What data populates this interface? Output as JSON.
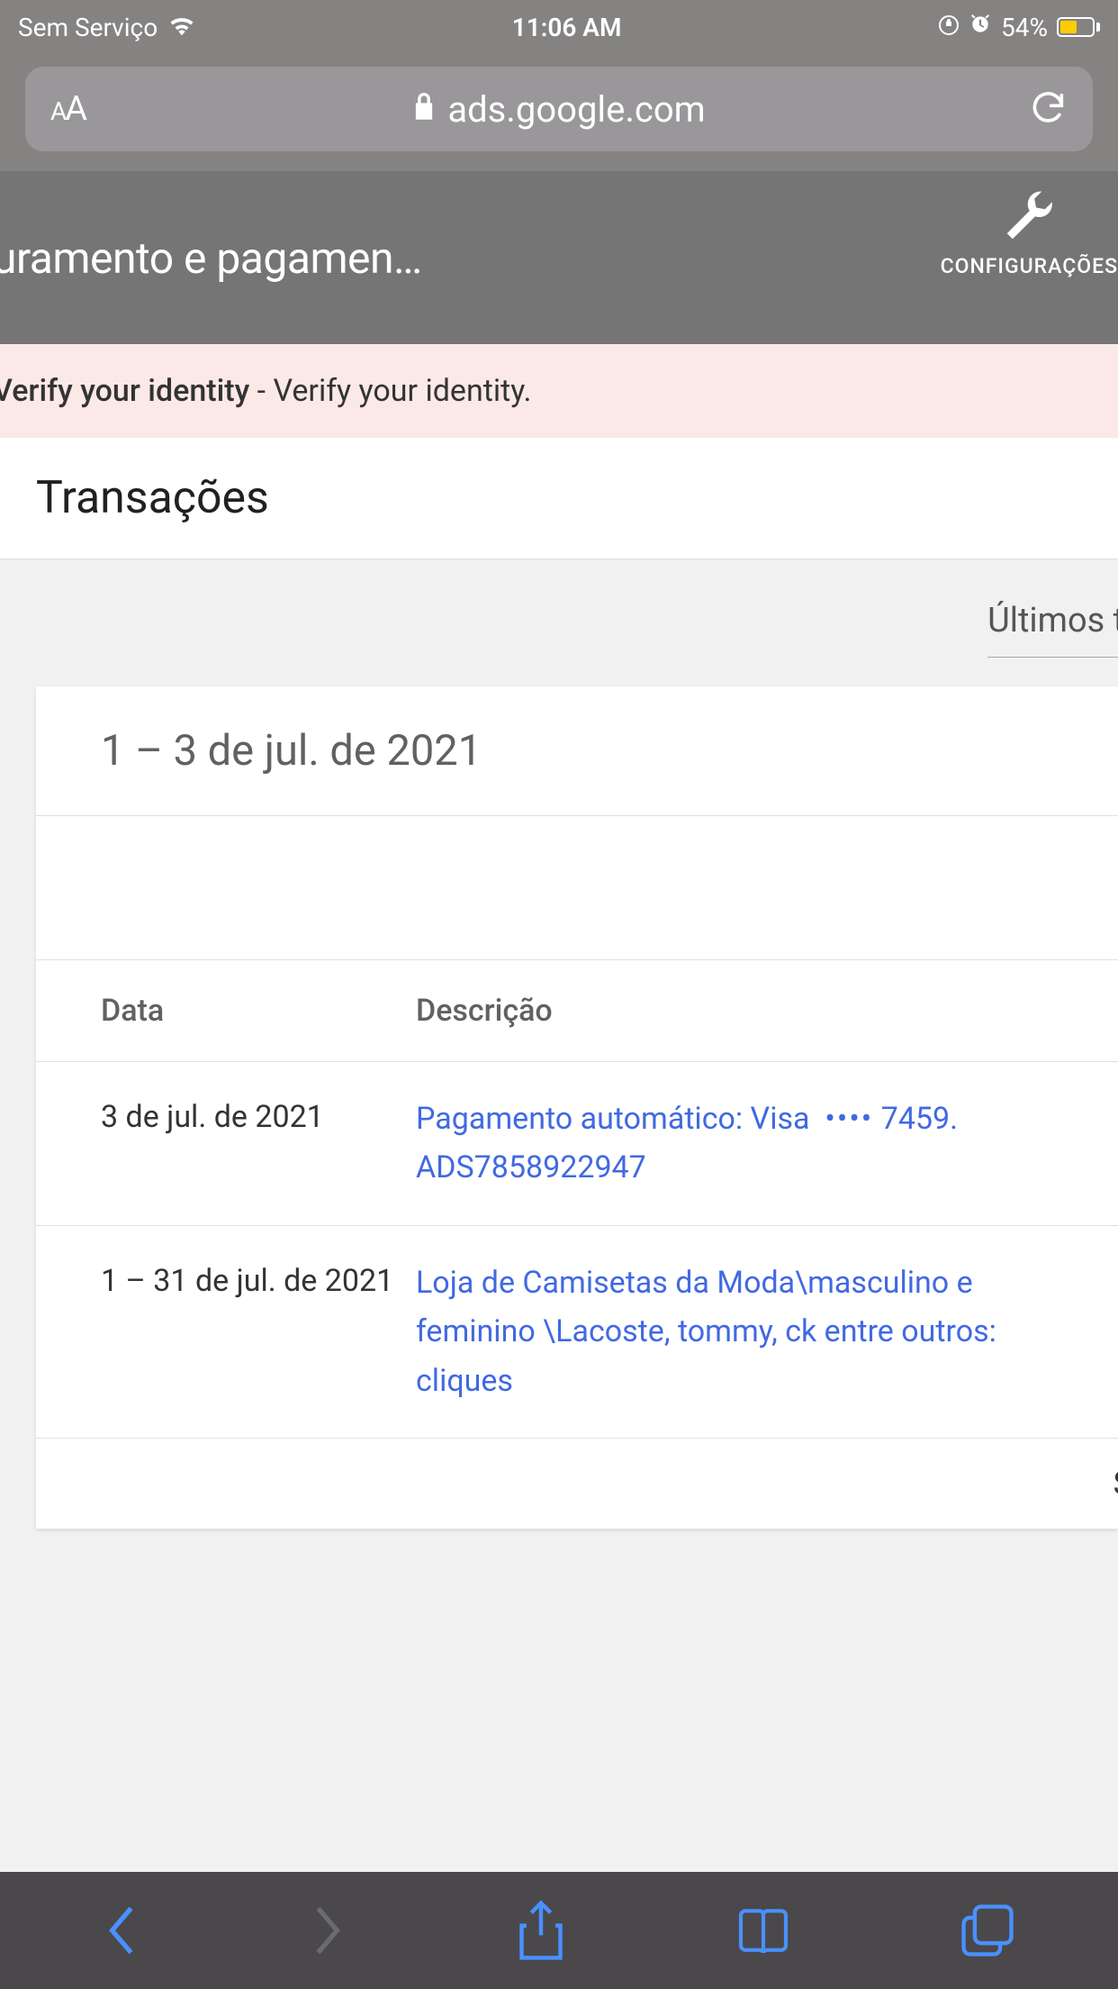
{
  "status_bar": {
    "carrier": "Sem Serviço",
    "time": "11:06 AM",
    "battery_pct": "54%"
  },
  "url_bar": {
    "domain": "ads.google.com"
  },
  "header": {
    "title": "uramento e pagamen…",
    "settings_label": "CONFIGURAÇÕES"
  },
  "alert": {
    "bold": "Verify your identity",
    "rest": " - Verify your identity."
  },
  "section": {
    "title": "Transações",
    "filter": "Últimos tr"
  },
  "card": {
    "date_range": "1 – 3 de jul. de 2021"
  },
  "table": {
    "headers": {
      "date": "Data",
      "desc": "Descrição"
    },
    "rows": [
      {
        "date": "3 de jul. de 2021",
        "desc_pre": "Pagamento automático: Visa ",
        "desc_dots": "••••",
        "desc_post": " 7459. ADS7858922947"
      },
      {
        "date": "1 – 31 de jul. de 2021",
        "desc": "Loja de Camisetas da Moda\\masculino e feminino \\Lacoste, tommy, ck entre outros: cliques"
      }
    ],
    "summary": "S"
  }
}
